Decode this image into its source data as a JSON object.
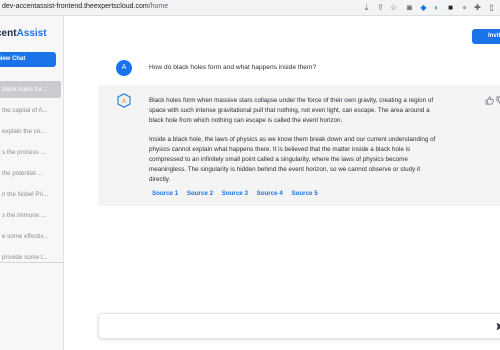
{
  "browser": {
    "url_host": "dev-accentassist-frontend.theexpertscloud.com",
    "url_path": "/home"
  },
  "brand": {
    "part1": "cent",
    "part2": "Assist"
  },
  "sidebar": {
    "new_chat_label": "New Chat",
    "history": [
      "black holes for...",
      "the capital of A...",
      "explain the co...",
      "s the process ...",
      "the potential ...",
      "n the Nobel Pri...",
      "s the immune ...",
      "e some effectiv...",
      "provide some t..."
    ]
  },
  "header": {
    "invite_label": "Invite"
  },
  "conversation": {
    "user_avatar": "A",
    "question": "How do black holes form and what happens inside them?",
    "answer_paragraphs": [
      "Black holes form when massive stars collapse under the force of their own gravity, creating a region of space with such intense gravitational pull that nothing, not even light, can escape. The area around a black hole from which nothing can escape is called the event horizon.",
      "Inside a black hole, the laws of physics as we know them break down and our current understanding of physics cannot explain what happens there. It is believed that the matter inside a black hole is compressed to an infinitely small point called a singularity, where the laws of physics become meaningless. The singularity is hidden behind the event horizon, so we cannot observe or study it directly."
    ],
    "sources": [
      "Source 1",
      "Source 2",
      "Source 3",
      "Source 4",
      "Source 5"
    ]
  },
  "composer": {
    "placeholder": ""
  },
  "icons": {
    "thumbs_up": "thumbs-up-icon",
    "thumbs_down": "thumbs-down-icon",
    "send": "send-icon",
    "bot": "bot-logo-icon"
  },
  "colors": {
    "accent": "#1a73e8",
    "answer_bg": "#f4f4f5",
    "sidebar_bg": "#f7f7f8"
  }
}
